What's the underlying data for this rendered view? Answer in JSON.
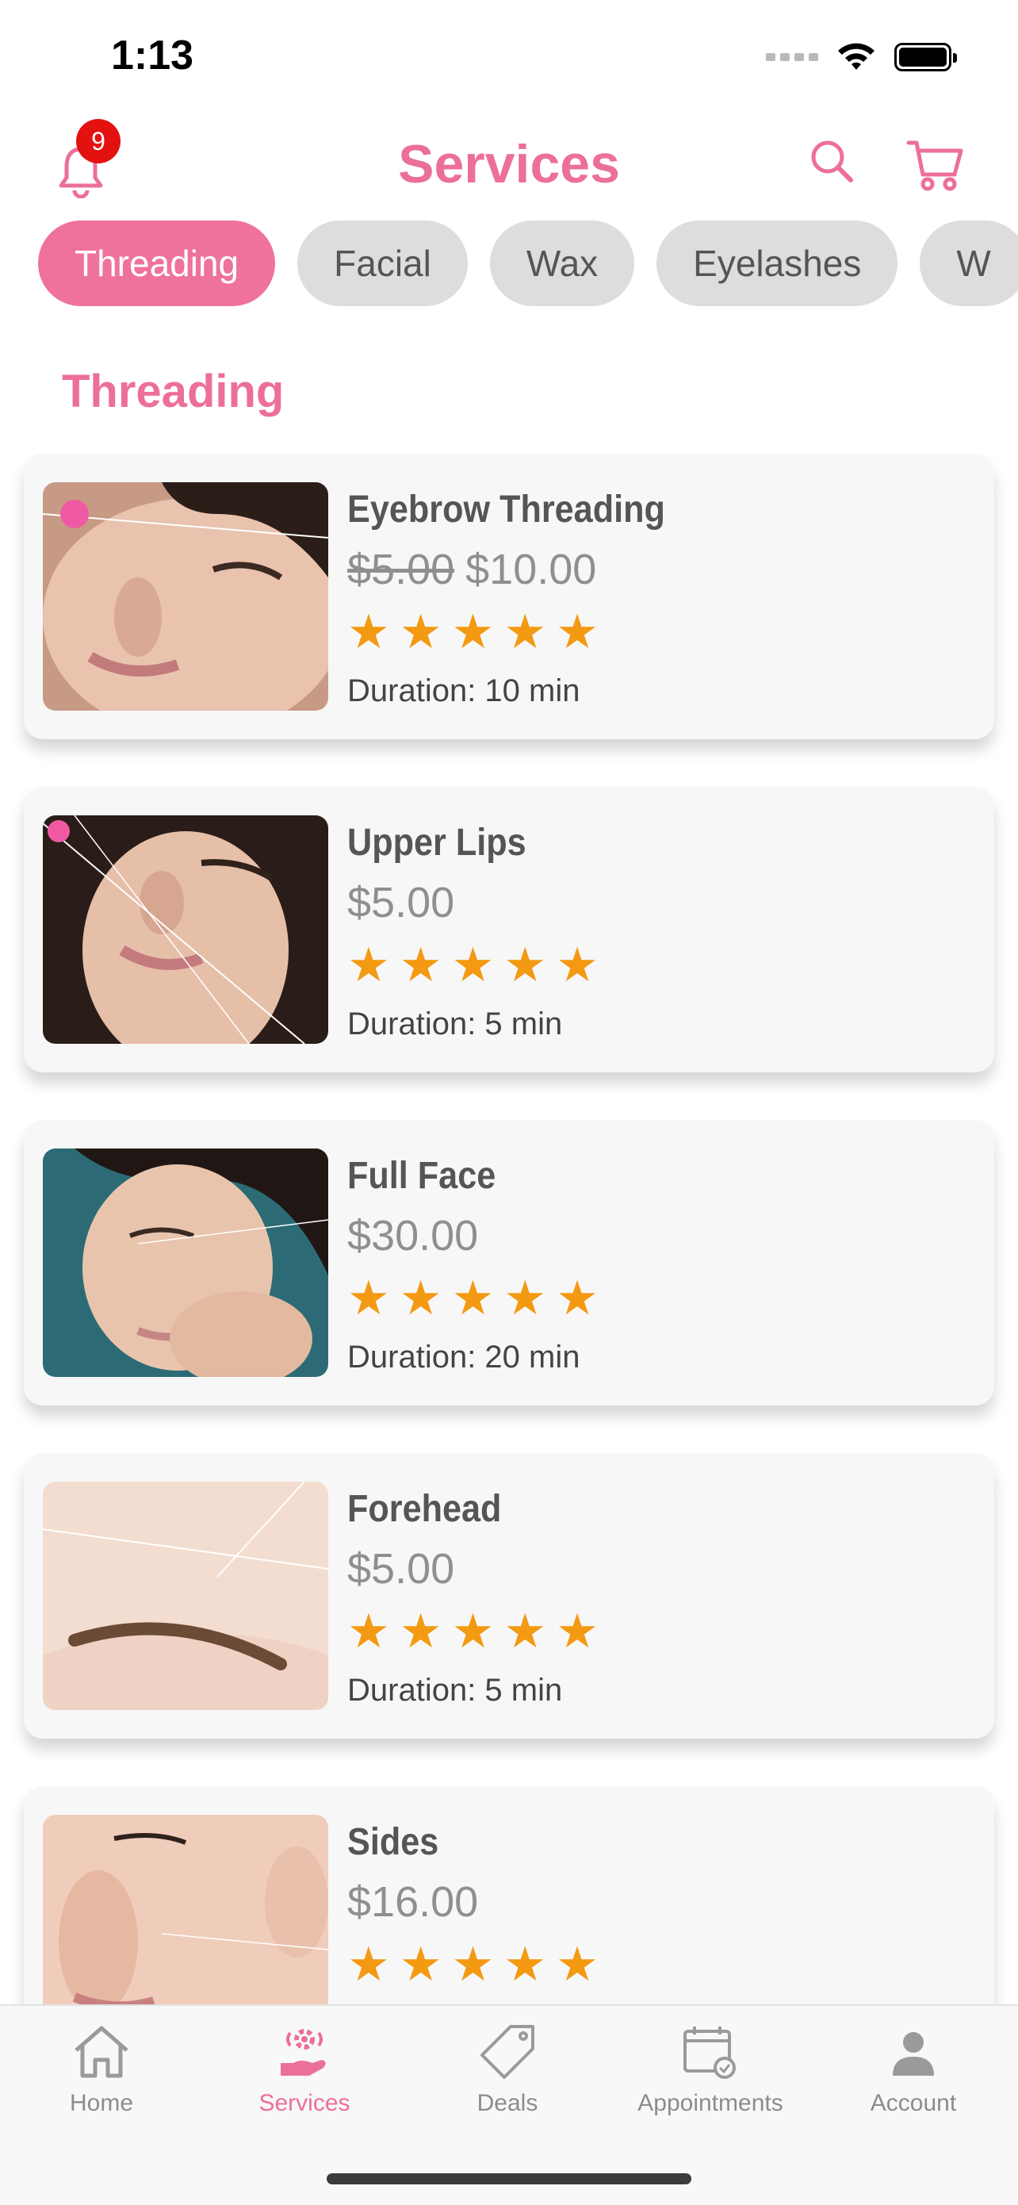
{
  "status_bar": {
    "time": "1:13"
  },
  "header": {
    "title": "Services",
    "notification_count": "9"
  },
  "categories": [
    {
      "label": "Threading",
      "active": true
    },
    {
      "label": "Facial",
      "active": false
    },
    {
      "label": "Wax",
      "active": false
    },
    {
      "label": "Eyelashes",
      "active": false
    },
    {
      "label": "W",
      "active": false
    }
  ],
  "section_title": "Threading",
  "services": [
    {
      "name": "Eyebrow Threading",
      "old_price": "$5.00",
      "price": "$10.00",
      "stars": "★★★★★",
      "rating": 5,
      "duration": "Duration: 10 min"
    },
    {
      "name": "Upper Lips",
      "old_price": "",
      "price": "$5.00",
      "stars": "★★★★★",
      "rating": 5,
      "duration": "Duration: 5 min"
    },
    {
      "name": "Full Face",
      "old_price": "",
      "price": "$30.00",
      "stars": "★★★★★",
      "rating": 5,
      "duration": "Duration: 20 min"
    },
    {
      "name": "Forehead",
      "old_price": "",
      "price": "$5.00",
      "stars": "★★★★★",
      "rating": 5,
      "duration": "Duration: 5 min"
    },
    {
      "name": "Sides",
      "old_price": "",
      "price": "$16.00",
      "stars": "★★★★★",
      "rating": 5,
      "duration": ""
    }
  ],
  "tabs": [
    {
      "label": "Home",
      "icon": "home-icon",
      "active": false
    },
    {
      "label": "Services",
      "icon": "services-icon",
      "active": true
    },
    {
      "label": "Deals",
      "icon": "tag-icon",
      "active": false
    },
    {
      "label": "Appointments",
      "icon": "calendar-icon",
      "active": false
    },
    {
      "label": "Account",
      "icon": "person-icon",
      "active": false
    }
  ],
  "colors": {
    "accent": "#ec6f9a",
    "star": "#f39a12",
    "badge": "#e41111",
    "chip_inactive": "#dddddd"
  }
}
